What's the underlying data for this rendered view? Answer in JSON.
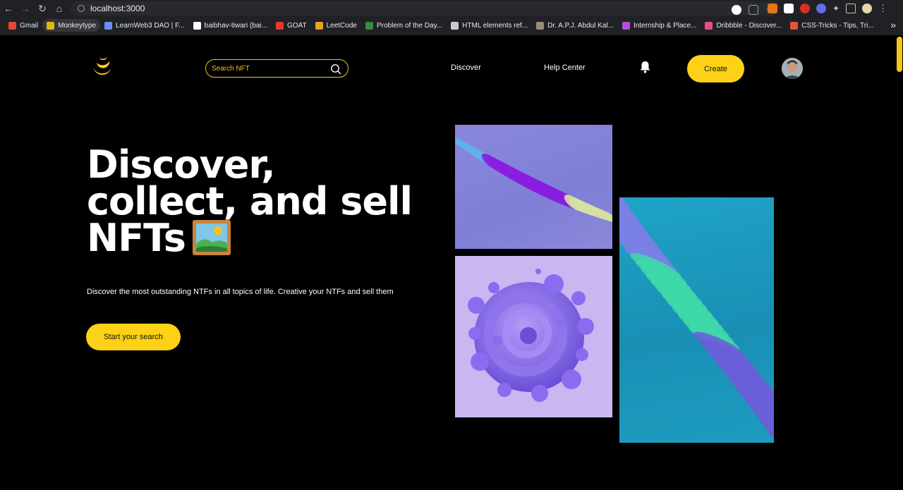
{
  "browser": {
    "url": "localhost:3000",
    "bookmarks": [
      {
        "label": "Gmail",
        "color": "#ea4335"
      },
      {
        "label": "Monkeytype",
        "color": "#e2b714"
      },
      {
        "label": "LearnWeb3 DAO | F...",
        "color": "#6b8cff"
      },
      {
        "label": "baibhav-tiwari (bai...",
        "color": "#ffffff"
      },
      {
        "label": "GOAT",
        "color": "#e53935"
      },
      {
        "label": "LeetCode",
        "color": "#f0a020"
      },
      {
        "label": "Problem of the Day...",
        "color": "#2f8d46"
      },
      {
        "label": "HTML elements ref...",
        "color": "#cccccc"
      },
      {
        "label": "Dr. A.P.J. Abdul Kal...",
        "color": "#9a8b7a"
      },
      {
        "label": "Internship & Place...",
        "color": "#b44cdc"
      },
      {
        "label": "Dribbble - Discover...",
        "color": "#ea4c89"
      },
      {
        "label": "CSS-Tricks - Tips, Tri...",
        "color": "#e5533c"
      }
    ],
    "more": "»"
  },
  "header": {
    "search_placeholder": "Search NFT",
    "nav": [
      "Discover",
      "Help Center"
    ],
    "create_label": "Create"
  },
  "hero": {
    "title_lines": [
      "Discover,",
      "collect, and sell",
      "NFTs"
    ],
    "subtitle": "Discover the most outstanding NTFs in all topics of life. Creative your NTFs and sell them",
    "cta_label": "Start your search"
  },
  "colors": {
    "accent": "#fcd116",
    "background": "#000000"
  }
}
